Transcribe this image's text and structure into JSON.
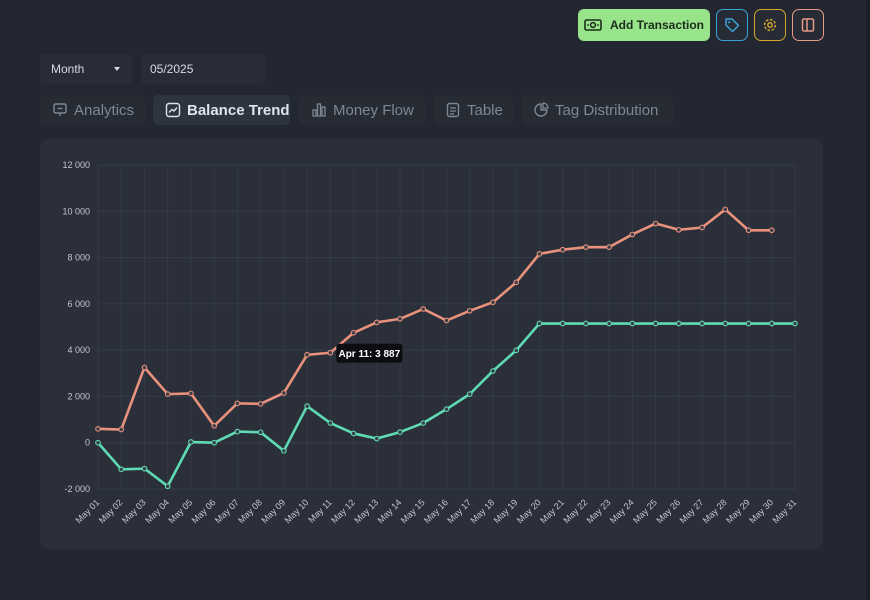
{
  "header": {
    "add_label": "Add Transaction"
  },
  "filters": {
    "period": "Month",
    "date": "05/2025"
  },
  "tabs": [
    {
      "label": "Analytics",
      "icon": "analytics-icon",
      "active": false
    },
    {
      "label": "Balance Trend",
      "icon": "trend-icon",
      "active": true
    },
    {
      "label": "Money Flow",
      "icon": "bar-chart-icon",
      "active": false
    },
    {
      "label": "Table",
      "icon": "table-icon",
      "active": false
    },
    {
      "label": "Tag Distribution",
      "icon": "pie-icon",
      "active": false
    }
  ],
  "colors": {
    "series_orange": "#e8917c",
    "series_green": "#5fdbb4",
    "add_button": "#98e48b"
  },
  "chart_data": {
    "type": "line",
    "ylim": [
      -2000,
      12000
    ],
    "yticks": [
      -2000,
      0,
      2000,
      4000,
      6000,
      8000,
      10000,
      12000
    ],
    "ytick_labels": [
      "-2 000",
      "0",
      "2 000",
      "4 000",
      "6 000",
      "8 000",
      "10 000",
      "12 000"
    ],
    "grid": true,
    "x": [
      "May 01",
      "May 02",
      "May 03",
      "May 04",
      "May 05",
      "May 06",
      "May 07",
      "May 08",
      "May 09",
      "May 10",
      "May 11",
      "May 12",
      "May 13",
      "May 14",
      "May 15",
      "May 16",
      "May 17",
      "May 18",
      "May 19",
      "May 20",
      "May 21",
      "May 22",
      "May 23",
      "May 24",
      "May 25",
      "May 26",
      "May 27",
      "May 28",
      "May 29",
      "May 30",
      "May 31"
    ],
    "series": [
      {
        "color": "#e8917c",
        "values": [
          600,
          570,
          3250,
          2100,
          2130,
          730,
          1700,
          1680,
          2150,
          3800,
          3887,
          4750,
          5200,
          5350,
          5780,
          5280,
          5700,
          6070,
          6930,
          8160,
          8340,
          8450,
          8450,
          9000,
          9470,
          9200,
          9300,
          10080,
          9180,
          9180,
          null
        ]
      },
      {
        "color": "#5fdbb4",
        "values": [
          0,
          -1150,
          -1120,
          -1880,
          30,
          0,
          480,
          450,
          -350,
          1580,
          850,
          400,
          180,
          460,
          850,
          1450,
          2100,
          3100,
          3990,
          5150,
          5150,
          5150,
          5150,
          5150,
          5150,
          5150,
          5150,
          5150,
          5150,
          5150,
          5150
        ]
      }
    ],
    "tooltip": {
      "label": "Apr 11: 3 887"
    }
  }
}
